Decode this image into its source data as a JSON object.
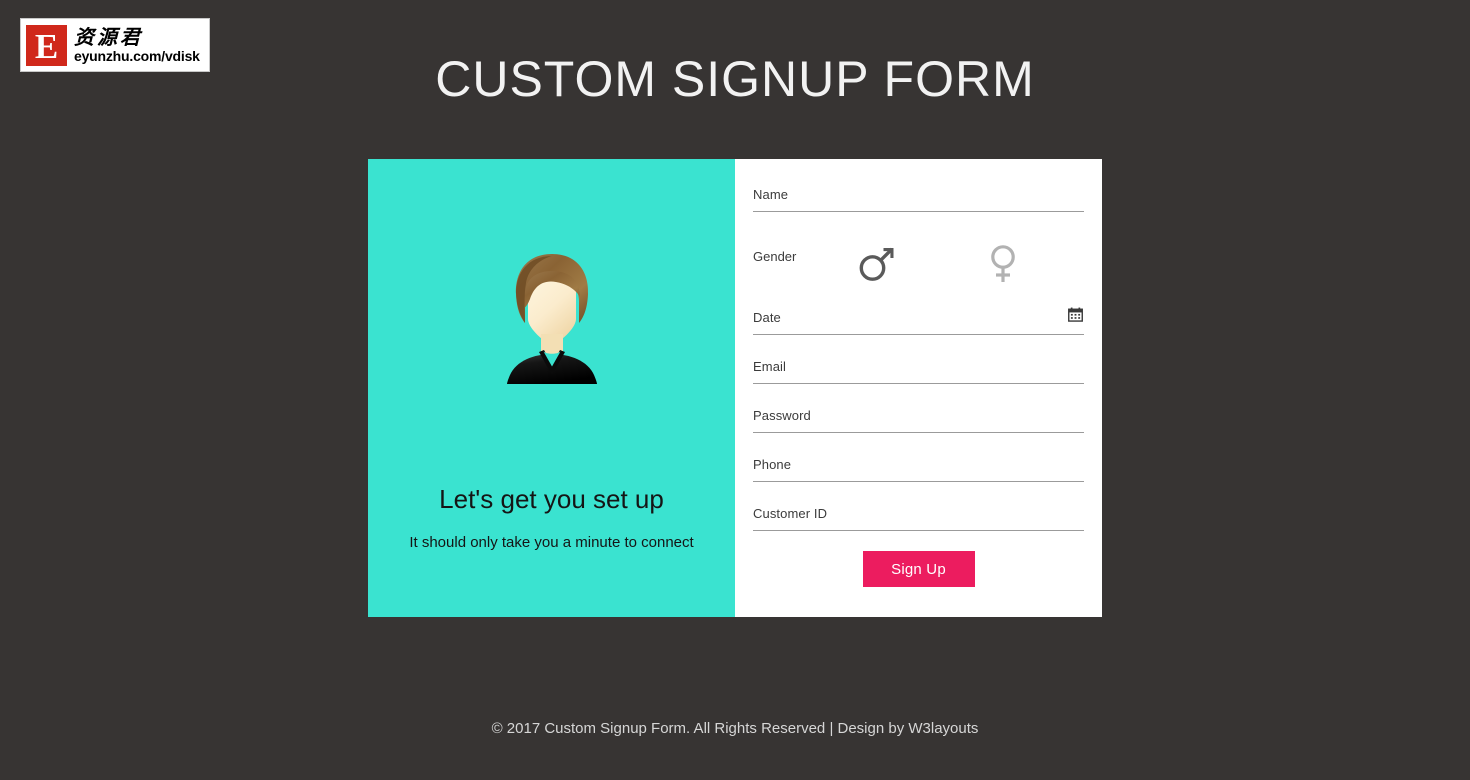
{
  "page": {
    "title": "CUSTOM SIGNUP FORM",
    "background_color": "#373433",
    "accent_teal": "#3ae3d0",
    "accent_pink": "#ec1c5f"
  },
  "watermark": {
    "badge_letter": "E",
    "chinese_name": "资源君",
    "url": "eyunzhu.com/vdisk",
    "badge_color": "#d0281b"
  },
  "intro": {
    "heading": "Let's get you set up",
    "subtext": "It should only take you a minute to connect",
    "avatar_alt": "user-avatar"
  },
  "form": {
    "fields": [
      {
        "id": "name",
        "label": "Name",
        "value": "",
        "placeholder": ""
      },
      {
        "id": "date",
        "label": "Date",
        "value": "",
        "placeholder": ""
      },
      {
        "id": "email",
        "label": "Email",
        "value": "",
        "placeholder": ""
      },
      {
        "id": "password",
        "label": "Password",
        "value": "",
        "placeholder": ""
      },
      {
        "id": "phone",
        "label": "Phone",
        "value": "",
        "placeholder": ""
      },
      {
        "id": "customer",
        "label": "Customer ID",
        "value": "",
        "placeholder": ""
      }
    ],
    "gender": {
      "label": "Gender",
      "male_icon": "male-gender-icon",
      "female_icon": "female-gender-icon",
      "male_color": "#5a5a5a",
      "female_color": "#b0b0b0",
      "selected": "male"
    },
    "calendar_icon": "calendar-icon",
    "submit_label": "Sign Up"
  },
  "footer": {
    "text": "© 2017 Custom Signup Form. All Rights Reserved | Design by W3layouts"
  }
}
